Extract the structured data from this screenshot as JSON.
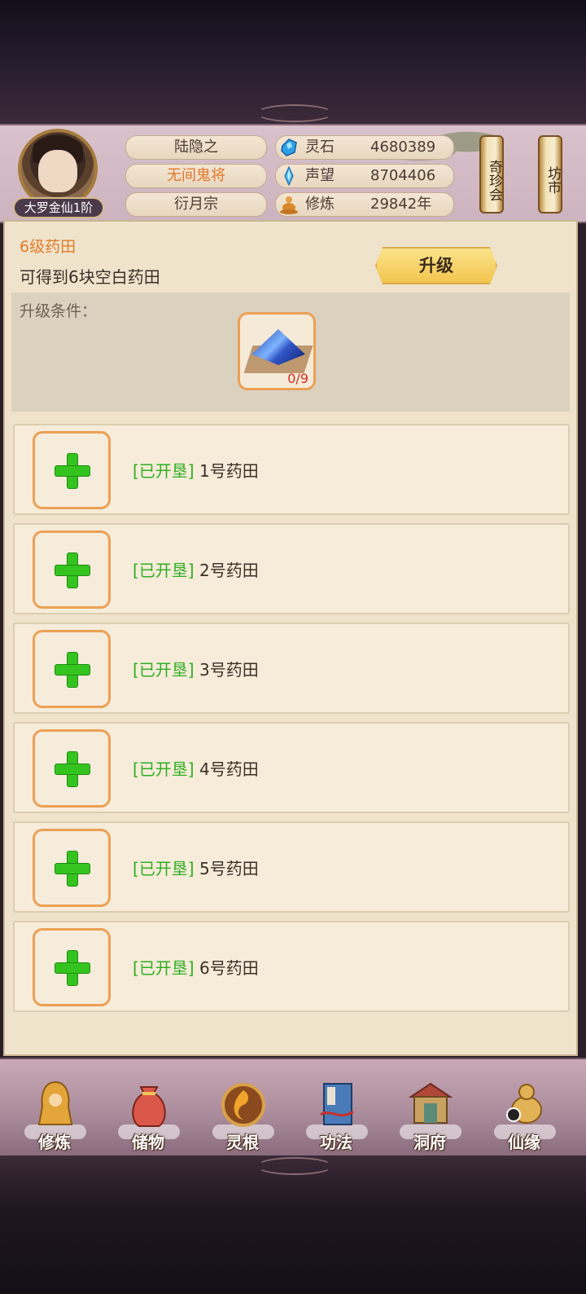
{
  "player": {
    "rank": "大罗金仙1阶",
    "name": "陆隐之",
    "title": "无间鬼将",
    "sect": "衍月宗"
  },
  "resources": [
    {
      "icon": "spirit-stone-icon",
      "label": "灵石",
      "value": "4680389"
    },
    {
      "icon": "reputation-crystal-icon",
      "label": "声望",
      "value": "8704406"
    },
    {
      "icon": "meditation-icon",
      "label": "修炼",
      "value": "29842年"
    }
  ],
  "side_buttons": [
    {
      "label": "奇珍会"
    },
    {
      "label": "坊市"
    }
  ],
  "garden": {
    "level_title": "6级药田",
    "description": "可得到6块空白药田",
    "upgrade_label": "升级",
    "condition_label": "升级条件：",
    "required_item": {
      "icon": "spirit-cloth-item-icon",
      "count": "0/9"
    }
  },
  "fields": [
    {
      "status": "[已开垦]",
      "name": "1号药田"
    },
    {
      "status": "[已开垦]",
      "name": "2号药田"
    },
    {
      "status": "[已开垦]",
      "name": "3号药田"
    },
    {
      "status": "[已开垦]",
      "name": "4号药田"
    },
    {
      "status": "[已开垦]",
      "name": "5号药田"
    },
    {
      "status": "[已开垦]",
      "name": "6号药田"
    }
  ],
  "nav": [
    {
      "label": "修炼",
      "icon": "cultivate-icon",
      "color": "#e3a53a"
    },
    {
      "label": "储物",
      "icon": "storage-bag-icon",
      "color": "#d9584a"
    },
    {
      "label": "灵根",
      "icon": "spirit-root-icon",
      "color": "#d98a2a"
    },
    {
      "label": "功法",
      "icon": "technique-book-icon",
      "color": "#4a7ab8"
    },
    {
      "label": "洞府",
      "icon": "cave-dwelling-icon",
      "color": "#c9a262"
    },
    {
      "label": "仙缘",
      "icon": "immortal-fate-icon",
      "color": "#e2b356"
    }
  ],
  "colors": {
    "accent_orange": "#e07c2a",
    "status_green": "#2fae22",
    "slot_border": "#eba055"
  }
}
